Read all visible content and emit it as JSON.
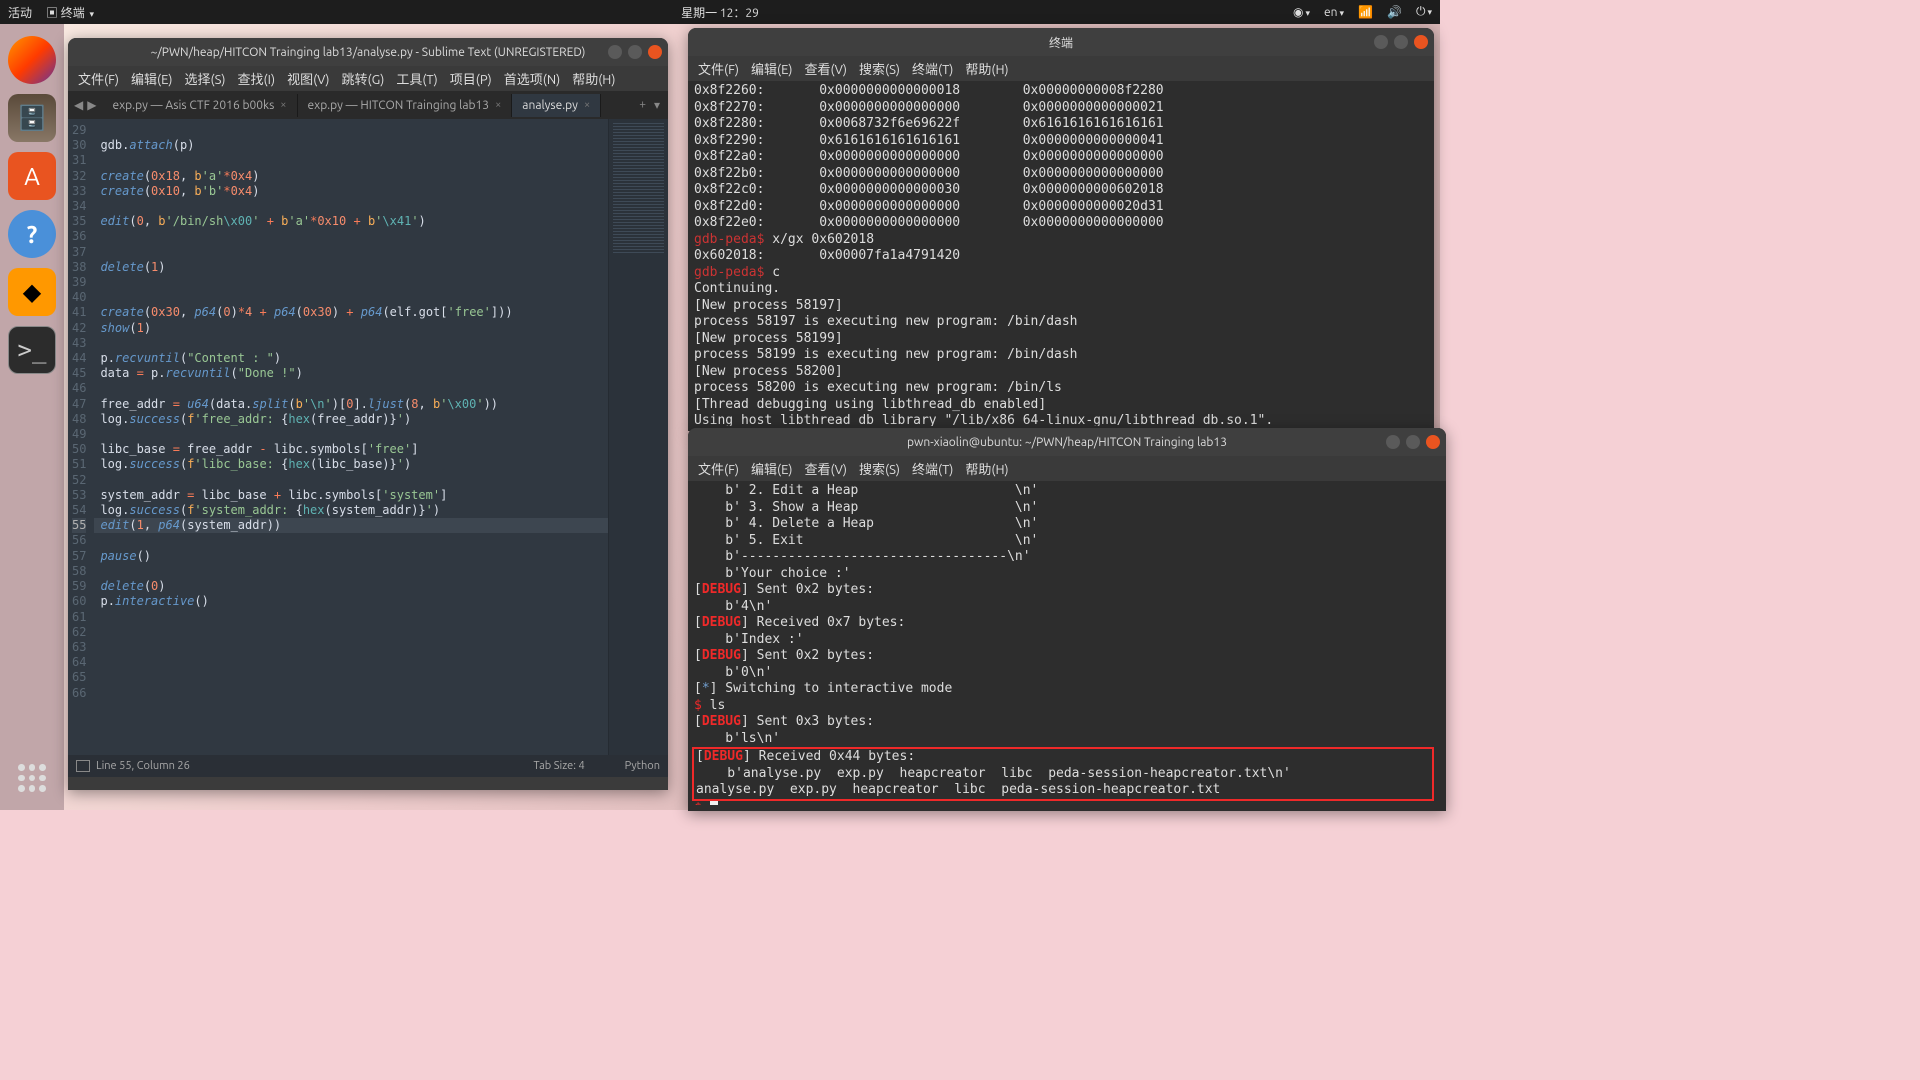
{
  "panel": {
    "activities": "活动",
    "app_menu": "终端",
    "clock": "星期一 12：29",
    "lang": "en"
  },
  "dock": {
    "items": [
      "firefox",
      "files",
      "software",
      "help",
      "sublime",
      "terminal"
    ]
  },
  "sublime": {
    "title": "~/PWN/heap/HITCON Trainging lab13/analyse.py - Sublime Text (UNREGISTERED)",
    "menu": [
      "文件(F)",
      "编辑(E)",
      "选择(S)",
      "查找(I)",
      "视图(V)",
      "跳转(G)",
      "工具(T)",
      "项目(P)",
      "首选项(N)",
      "帮助(H)"
    ],
    "tabs": [
      {
        "label": "exp.py — Asis CTF 2016 b00ks",
        "active": false
      },
      {
        "label": "exp.py — HITCON Trainging lab13",
        "active": false
      },
      {
        "label": "analyse.py",
        "active": true
      }
    ],
    "line_start": 29,
    "highlighted_line": 55,
    "status": {
      "pos": "Line 55, Column 26",
      "tab": "Tab Size: 4",
      "lang": "Python"
    }
  },
  "term_menu": [
    "文件(F)",
    "编辑(E)",
    "查看(V)",
    "搜索(S)",
    "终端(T)",
    "帮助(H)"
  ],
  "term1": {
    "title": "终端",
    "mem": [
      [
        "0x8f2260:",
        "0x0000000000000018",
        "0x00000000008f2280"
      ],
      [
        "0x8f2270:",
        "0x0000000000000000",
        "0x0000000000000021"
      ],
      [
        "0x8f2280:",
        "0x0068732f6e69622f",
        "0x6161616161616161"
      ],
      [
        "0x8f2290:",
        "0x6161616161616161",
        "0x0000000000000041"
      ],
      [
        "0x8f22a0:",
        "0x0000000000000000",
        "0x0000000000000000"
      ],
      [
        "0x8f22b0:",
        "0x0000000000000000",
        "0x0000000000000000"
      ],
      [
        "0x8f22c0:",
        "0x0000000000000030",
        "0x0000000000602018"
      ],
      [
        "0x8f22d0:",
        "0x0000000000000000",
        "0x0000000000020d31"
      ],
      [
        "0x8f22e0:",
        "0x0000000000000000",
        "0x0000000000000000"
      ]
    ],
    "prompt": "gdb-peda$",
    "cmd1": "x/gx 0x602018",
    "line1": "0x602018:       0x00007fa1a4791420",
    "cmd2": "c",
    "cont": "Continuing.",
    "lines": [
      "[New process 58197]",
      "process 58197 is executing new program: /bin/dash",
      "[New process 58199]",
      "process 58199 is executing new program: /bin/dash",
      "[New process 58200]",
      "process 58200 is executing new program: /bin/ls",
      "[Thread debugging using libthread_db enabled]",
      "Using host libthread_db library \"/lib/x86_64-linux-gnu/libthread_db.so.1\"."
    ]
  },
  "term2": {
    "title": "pwn-xiaolin@ubuntu: ~/PWN/heap/HITCON Trainging lab13",
    "menu_items": [
      "    b' 2. Edit a Heap                    \\n'",
      "    b' 3. Show a Heap                    \\n'",
      "    b' 4. Delete a Heap                  \\n'",
      "    b' 5. Exit                           \\n'",
      "    b'----------------------------------\\n'",
      "    b'Your choice :'"
    ],
    "d1": "] Sent 0x2 bytes:",
    "b1": "    b'4\\n'",
    "d2": "] Received 0x7 bytes:",
    "b2": "    b'Index :'",
    "d3": "] Sent 0x2 bytes:",
    "b3": "    b'0\\n'",
    "sw": "] Switching to interactive mode",
    "shell_cmd": "ls",
    "d4": "] Sent 0x3 bytes:",
    "b4": "    b'ls\\n'",
    "d5": "] Received 0x44 bytes:",
    "b5": "    b'analyse.py  exp.py  heapcreator  libc  peda-session-heapcreator.txt\\n'",
    "ls_out": "analyse.py  exp.py  heapcreator  libc  peda-session-heapcreator.txt"
  }
}
